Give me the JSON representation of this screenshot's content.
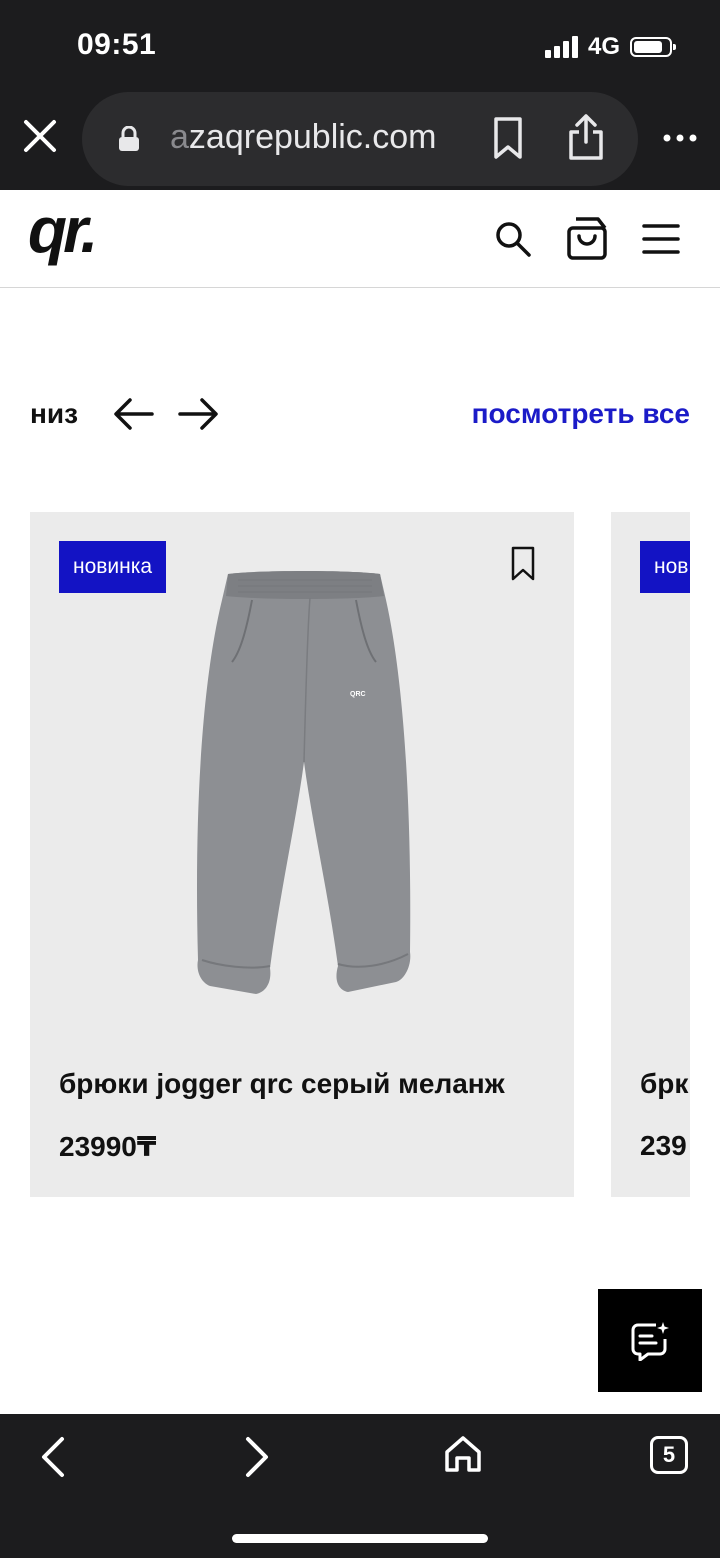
{
  "status_bar": {
    "time": "09:51",
    "network": "4G"
  },
  "browser": {
    "url_faded": "a",
    "url_text": "zaqrepublic.com",
    "open_tabs": "5"
  },
  "site": {
    "logo": "qr.",
    "section_title": "низ",
    "view_all": "посмотреть все"
  },
  "products": [
    {
      "badge": "новинка",
      "name": "брюки jogger qrc серый меланж",
      "price": "23990₸",
      "print": "QRC"
    },
    {
      "badge": "нов",
      "name": "брк",
      "price": "239"
    }
  ],
  "colors": {
    "badge_bg": "#1313c4",
    "link": "#1b1bc8",
    "card_bg": "#ebebeb",
    "chrome_bg": "#1c1c1e"
  }
}
